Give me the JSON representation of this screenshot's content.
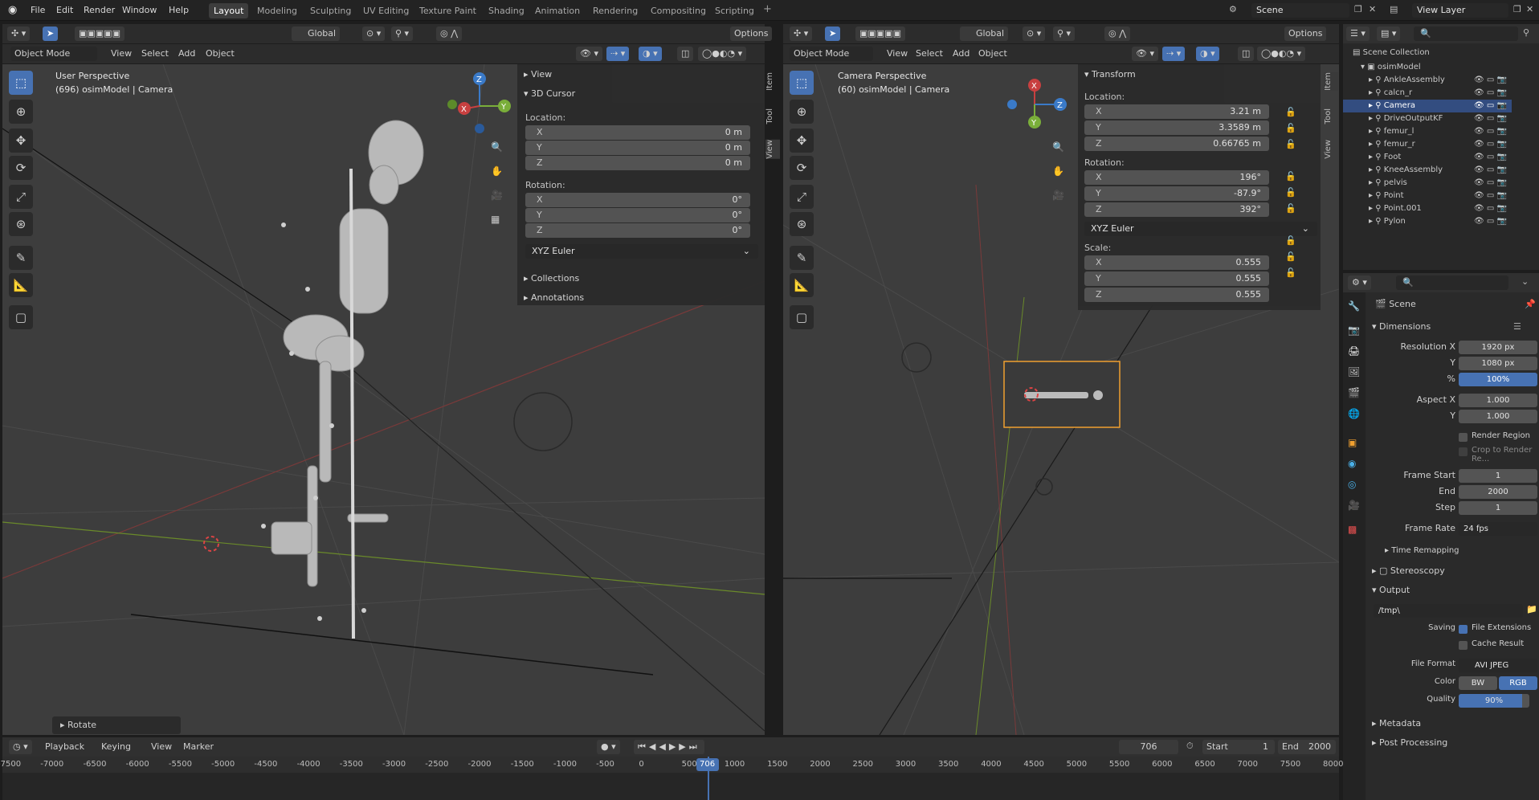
{
  "topbar": {
    "menus": [
      "File",
      "Edit",
      "Render",
      "Window",
      "Help"
    ],
    "workspaces": [
      "Layout",
      "Modeling",
      "Sculpting",
      "UV Editing",
      "Texture Paint",
      "Shading",
      "Animation",
      "Rendering",
      "Compositing",
      "Scripting"
    ],
    "active_workspace": "Layout",
    "scene": "Scene",
    "view_layer": "View Layer"
  },
  "left_view": {
    "mode": "Object Mode",
    "menus": [
      "View",
      "Select",
      "Add",
      "Object"
    ],
    "orientation": "Global",
    "options": "Options",
    "overlay_line1": "User Perspective",
    "overlay_line2": "(696) osimModel | Camera",
    "npanel": {
      "view": "View",
      "cursor": "3D Cursor",
      "location_label": "Location:",
      "location": [
        {
          "axis": "X",
          "value": "0 m"
        },
        {
          "axis": "Y",
          "value": "0 m"
        },
        {
          "axis": "Z",
          "value": "0 m"
        }
      ],
      "rotation_label": "Rotation:",
      "rotation": [
        {
          "axis": "X",
          "value": "0°"
        },
        {
          "axis": "Y",
          "value": "0°"
        },
        {
          "axis": "Z",
          "value": "0°"
        }
      ],
      "rotation_mode": "XYZ Euler",
      "collections": "Collections",
      "annotations": "Annotations",
      "tabs": [
        "Item",
        "Tool",
        "View"
      ]
    },
    "last_op": "Rotate"
  },
  "right_view": {
    "mode": "Object Mode",
    "menus": [
      "View",
      "Select",
      "Add",
      "Object"
    ],
    "orientation": "Global",
    "options": "Options",
    "overlay_line1": "Camera Perspective",
    "overlay_line2": "(60) osimModel | Camera",
    "npanel": {
      "transform": "Transform",
      "location_label": "Location:",
      "location": [
        {
          "axis": "X",
          "value": "3.21 m"
        },
        {
          "axis": "Y",
          "value": "3.3589 m"
        },
        {
          "axis": "Z",
          "value": "0.66765 m"
        }
      ],
      "rotation_label": "Rotation:",
      "rotation": [
        {
          "axis": "X",
          "value": "196°"
        },
        {
          "axis": "Y",
          "value": "-87.9°"
        },
        {
          "axis": "Z",
          "value": "392°"
        }
      ],
      "rotation_mode": "XYZ Euler",
      "scale_label": "Scale:",
      "scale": [
        {
          "axis": "X",
          "value": "0.555"
        },
        {
          "axis": "Y",
          "value": "0.555"
        },
        {
          "axis": "Z",
          "value": "0.555"
        }
      ],
      "tabs": [
        "Item",
        "Tool",
        "View"
      ]
    }
  },
  "outliner": {
    "root": "Scene Collection",
    "collection": "osimModel",
    "items": [
      "AnkleAssembly",
      "calcn_r",
      "Camera",
      "DriveOutputKF",
      "femur_l",
      "femur_r",
      "Foot",
      "KneeAssembly",
      "pelvis",
      "Point",
      "Point.001",
      "Pylon"
    ],
    "selected": "Camera"
  },
  "properties": {
    "context": "Scene",
    "dimensions": "Dimensions",
    "res_x_label": "Resolution X",
    "res_x": "1920 px",
    "res_y_label": "Y",
    "res_y": "1080 px",
    "res_pct_label": "%",
    "res_pct": "100%",
    "aspect_x_label": "Aspect X",
    "aspect_x": "1.000",
    "aspect_y_label": "Y",
    "aspect_y": "1.000",
    "render_region": "Render Region",
    "crop": "Crop to Render Re...",
    "frame_start_label": "Frame Start",
    "frame_start": "1",
    "frame_end_label": "End",
    "frame_end": "2000",
    "frame_step_label": "Step",
    "frame_step": "1",
    "frame_rate_label": "Frame Rate",
    "frame_rate": "24 fps",
    "time_remapping": "Time Remapping",
    "stereoscopy": "Stereoscopy",
    "output": "Output",
    "output_path": "/tmp\\",
    "saving_label": "Saving",
    "file_ext": "File Extensions",
    "cache_result": "Cache Result",
    "file_format_label": "File Format",
    "file_format": "AVI JPEG",
    "color_label": "Color",
    "color_bw": "BW",
    "color_rgb": "RGB",
    "quality_label": "Quality",
    "quality": "90%",
    "quality_fraction": 0.9,
    "metadata": "Metadata",
    "post_processing": "Post Processing"
  },
  "timeline": {
    "menus": [
      "Playback",
      "Keying",
      "View",
      "Marker"
    ],
    "current_frame": "706",
    "start_label": "Start",
    "start": "1",
    "end_label": "End",
    "end": "2000",
    "ticks": [
      "-7500",
      "-7000",
      "-6500",
      "-6000",
      "-5500",
      "-5000",
      "-4500",
      "-4000",
      "-3500",
      "-3000",
      "-2500",
      "-2000",
      "-1500",
      "-1000",
      "-500",
      "0",
      "500",
      "1000",
      "1500",
      "2000",
      "2500",
      "3000",
      "3500",
      "4000",
      "4500",
      "5000",
      "5500",
      "6000",
      "6500",
      "7000",
      "7500",
      "8000"
    ],
    "playhead": "706"
  }
}
